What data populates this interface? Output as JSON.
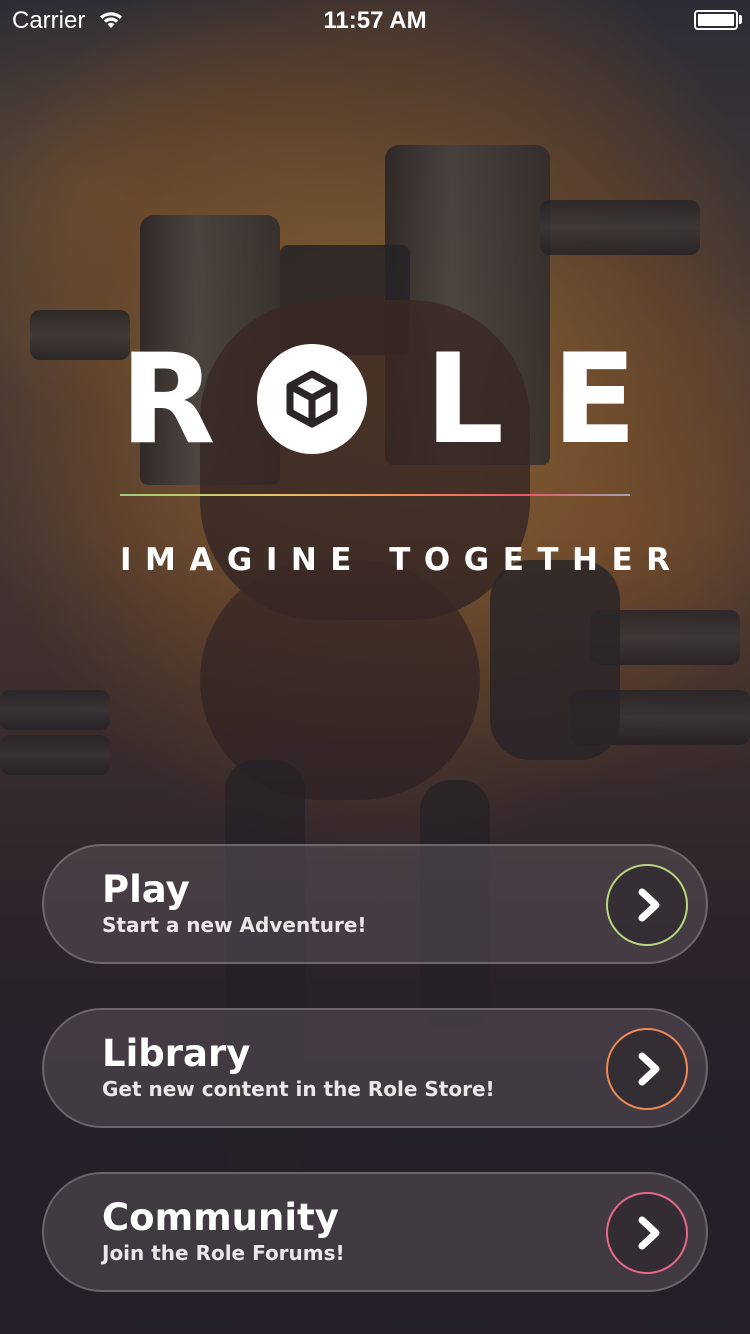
{
  "status_bar": {
    "carrier": "Carrier",
    "time": "11:57 AM",
    "wifi_icon": "wifi-icon",
    "battery_icon": "battery-icon"
  },
  "logo": {
    "letters": [
      "R",
      "L",
      "E"
    ],
    "o_icon": "cube-icon"
  },
  "tagline": "IMAGINE TOGETHER",
  "menu": [
    {
      "title": "Play",
      "subtitle": "Start a new Adventure!",
      "icon": "chevron-right-icon",
      "ring_color": "#b7d67e"
    },
    {
      "title": "Library",
      "subtitle": "Get new content in the Role Store!",
      "icon": "chevron-right-icon",
      "ring_color": "#f08a54"
    },
    {
      "title": "Community",
      "subtitle": "Join the Role Forums!",
      "icon": "chevron-right-icon",
      "ring_color": "#e8688a"
    }
  ]
}
